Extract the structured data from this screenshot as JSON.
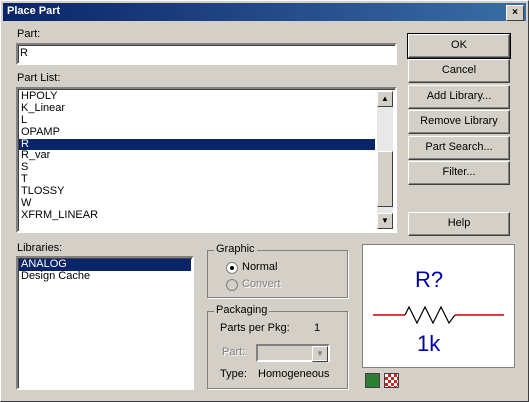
{
  "window": {
    "title": "Place Part",
    "close_symbol": "×"
  },
  "part": {
    "label": "Part:",
    "value": "R"
  },
  "part_list": {
    "label": "Part List:",
    "items": [
      "HPOLY",
      "K_Linear",
      "L",
      "OPAMP",
      "R",
      "R_var",
      "S",
      "T",
      "TLOSSY",
      "W",
      "XFRM_LINEAR"
    ],
    "selected_index": 4
  },
  "buttons": {
    "ok": "OK",
    "cancel": "Cancel",
    "add_library": "Add Library...",
    "remove_library": "Remove Library",
    "part_search": "Part Search...",
    "filter": "Filter...",
    "help": "Help"
  },
  "libraries": {
    "label": "Libraries:",
    "items": [
      "ANALOG",
      "Design Cache"
    ],
    "selected_index": 0
  },
  "graphic": {
    "title": "Graphic",
    "normal": "Normal",
    "convert": "Convert",
    "selected": "normal"
  },
  "packaging": {
    "title": "Packaging",
    "parts_per_pkg_label": "Parts per Pkg:",
    "parts_per_pkg_value": "1",
    "part_label": "Part:",
    "type_label": "Type:",
    "type_value": "Homogeneous"
  },
  "preview": {
    "ref": "R?",
    "value": "1k",
    "wire_color": "#cc0000",
    "text_color": "#0000aa"
  }
}
